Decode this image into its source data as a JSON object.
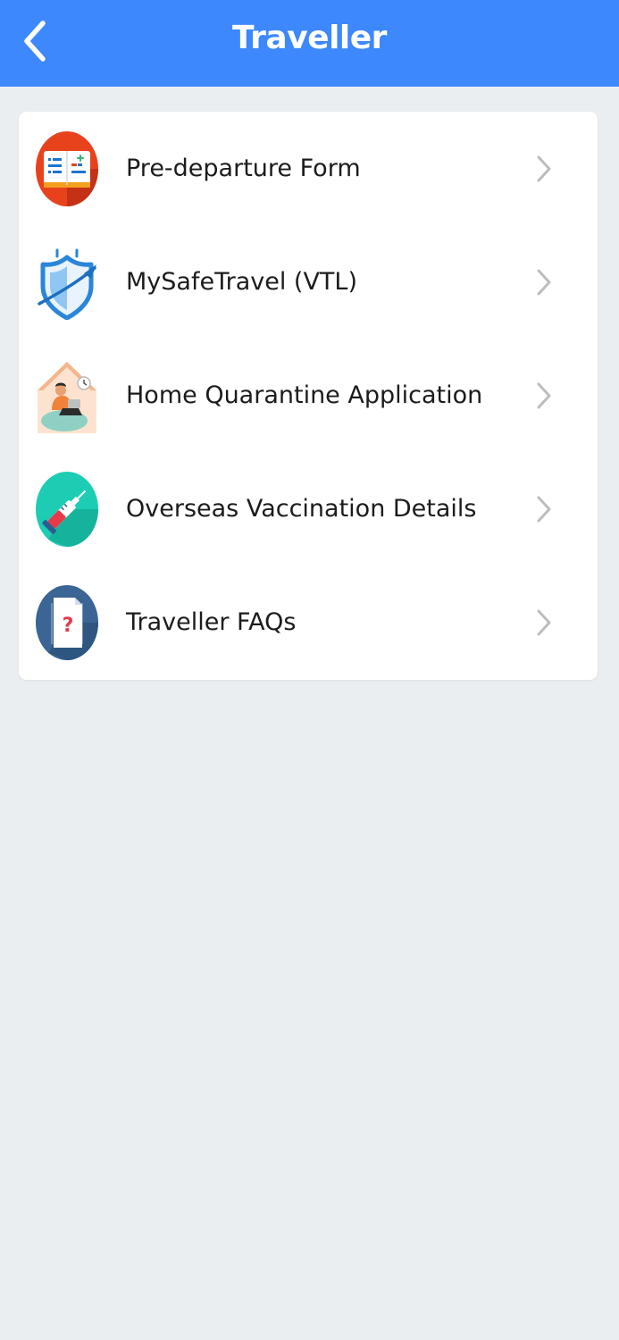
{
  "header": {
    "title": "Traveller",
    "back_icon": "chevron-left-icon"
  },
  "menu": {
    "items": [
      {
        "label": "Pre-departure Form",
        "icon": "form-icon"
      },
      {
        "label": "MySafeTravel (VTL)",
        "icon": "shield-plane-icon"
      },
      {
        "label": "Home Quarantine Application",
        "icon": "home-quarantine-icon"
      },
      {
        "label": "Overseas Vaccination Details",
        "icon": "syringe-icon"
      },
      {
        "label": "Traveller FAQs",
        "icon": "faq-document-icon"
      }
    ]
  },
  "colors": {
    "header_bg": "#3d88fd",
    "page_bg": "#ebeef0",
    "card_bg": "#ffffff",
    "chevron": "#bdbdbd"
  }
}
